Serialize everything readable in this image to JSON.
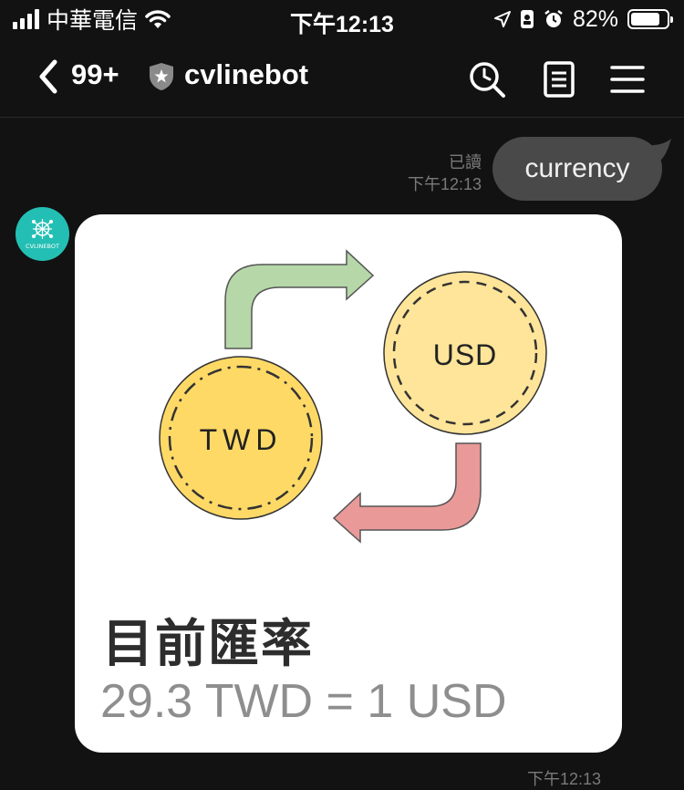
{
  "status_bar": {
    "carrier": "中華電信",
    "time": "下午12:13",
    "battery": "82%",
    "battery_level": 0.82
  },
  "header": {
    "unread_count": "99+",
    "chat_name": "cvlinebot"
  },
  "messages": {
    "user_message": {
      "text": "currency",
      "read_label": "已讀",
      "time": "下午12:13"
    },
    "bot_card": {
      "avatar_text": "CVLINEBOT",
      "from_currency": "TWD",
      "to_currency": "USD",
      "title": "目前匯率",
      "rate": "29.3 TWD = 1 USD",
      "time": "下午12:13"
    }
  },
  "colors": {
    "background": "#121212",
    "user_bubble": "#494949",
    "avatar": "#24bfb4",
    "coin_twd": "#ffd966",
    "coin_usd": "#ffe599",
    "arrow_green": "#b6d7a8",
    "arrow_red": "#ea9999"
  }
}
